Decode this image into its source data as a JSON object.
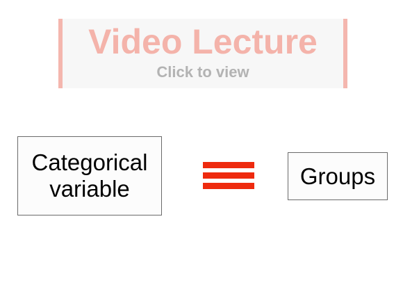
{
  "video_banner": {
    "title": "Video Lecture",
    "subtitle": "Click to view"
  },
  "left_box": {
    "line1": "Categorical",
    "line2": "variable"
  },
  "equivalence_symbol": {
    "icon": "identical-to-symbol",
    "color": "#ee2a0e"
  },
  "right_box": {
    "label": "Groups"
  },
  "colors": {
    "banner_border": "#f4b6ae",
    "banner_title": "#f4b3aa",
    "banner_subtitle": "#b3b3b3"
  }
}
